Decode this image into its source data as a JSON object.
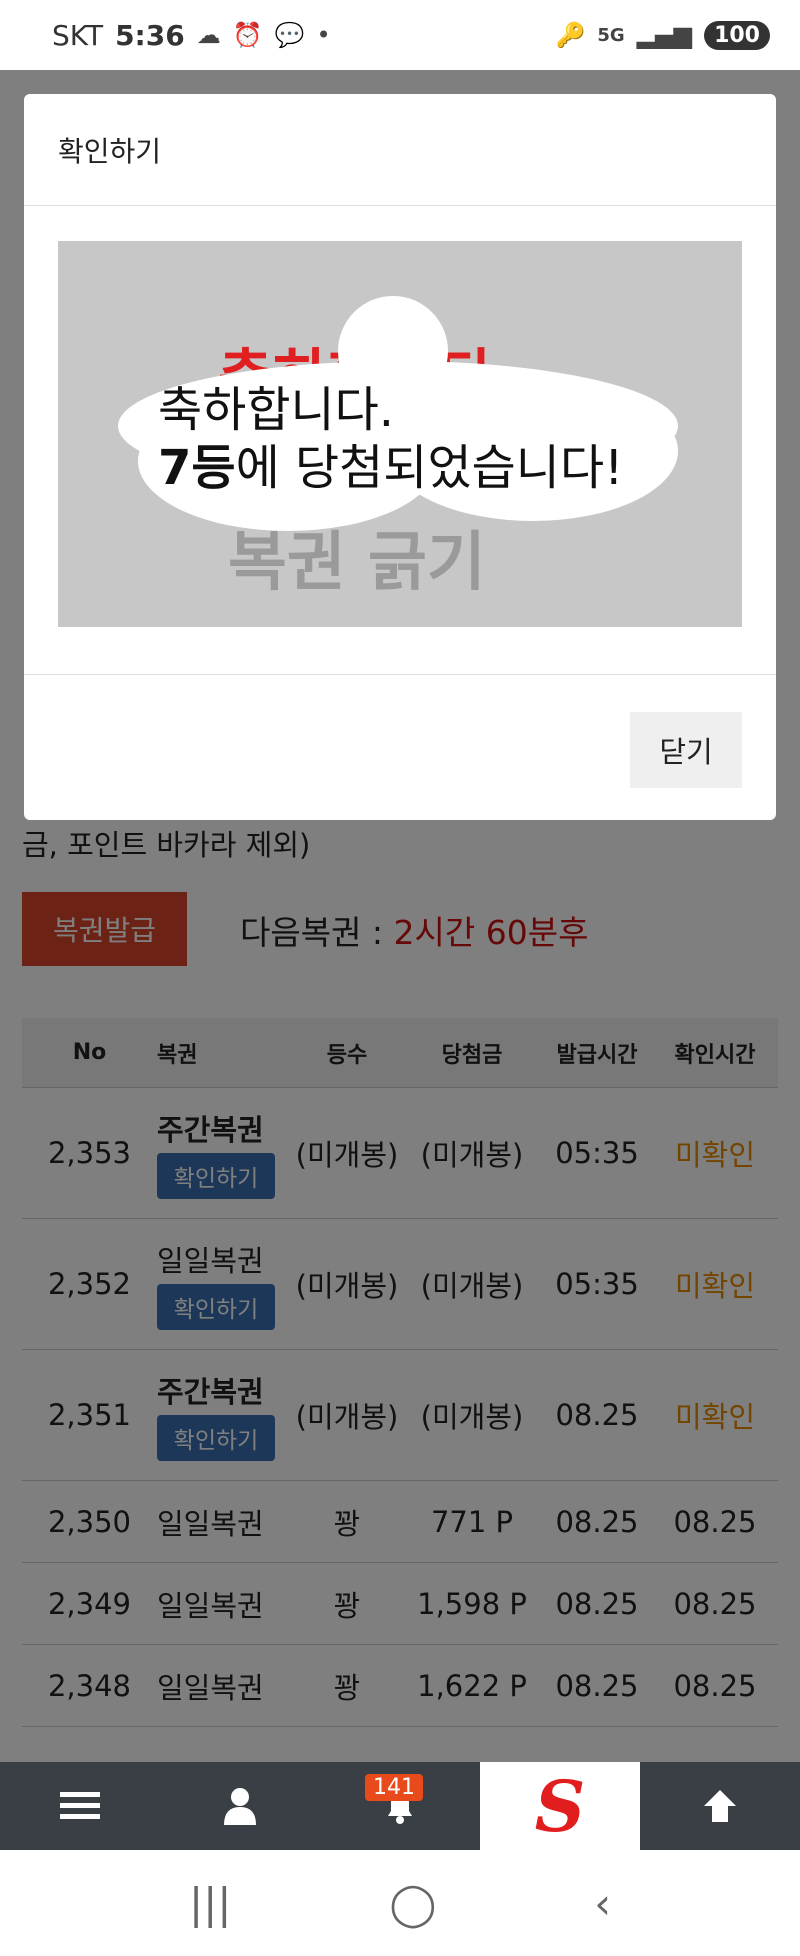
{
  "status_bar": {
    "carrier": "SKT",
    "time": "5:36",
    "dot": "•",
    "network": "5G",
    "battery": "100"
  },
  "page": {
    "notice_tail": "금, 포인트 바카라 제외)",
    "issue_button": "복권발급",
    "next_label": "다음복권 : ",
    "next_value": "2시간 60분후"
  },
  "table": {
    "headers": [
      "No",
      "복권",
      "등수",
      "당첨금",
      "발급시간",
      "확인시간"
    ],
    "check_label": "확인하기",
    "rows": [
      {
        "no": "2,353",
        "name": "주간복권",
        "rank": "(미개봉)",
        "prize": "(미개봉)",
        "issued": "05:35",
        "checked": "미확인"
      },
      {
        "no": "2,352",
        "name": "일일복권",
        "rank": "(미개봉)",
        "prize": "(미개봉)",
        "issued": "05:35",
        "checked": "미확인"
      },
      {
        "no": "2,351",
        "name": "주간복권",
        "rank": "(미개봉)",
        "prize": "(미개봉)",
        "issued": "08.25",
        "checked": "미확인"
      },
      {
        "no": "2,350",
        "name": "일일복권",
        "rank": "꽝",
        "prize": "771 P",
        "issued": "08.25",
        "checked": "08.25"
      },
      {
        "no": "2,349",
        "name": "일일복권",
        "rank": "꽝",
        "prize": "1,598 P",
        "issued": "08.25",
        "checked": "08.25"
      },
      {
        "no": "2,348",
        "name": "일일복권",
        "rank": "꽝",
        "prize": "1,622 P",
        "issued": "08.25",
        "checked": "08.25"
      }
    ]
  },
  "bottom_nav": {
    "badge_count": "141",
    "logo_letter": "S"
  },
  "modal": {
    "title": "확인하기",
    "scratch_bg_text": "복권 긁기",
    "scratch_red_text": "축하합니다",
    "line1": "축하합니다.",
    "line2_rank": "7등",
    "line2_rest": "에 당첨되었습니다!",
    "close_button": "닫기"
  },
  "colors": {
    "issue_button": "#d9442a",
    "check_button": "#3b6fb0",
    "unchecked": "#e58a00",
    "next_value": "#cc1111",
    "nav_bg": "#3a3f45",
    "badge": "#e84a1b"
  }
}
